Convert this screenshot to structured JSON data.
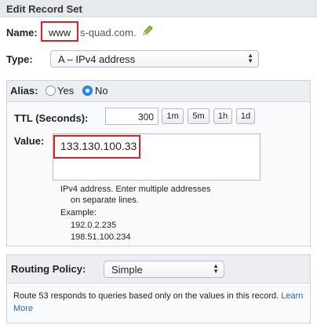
{
  "header": {
    "title": "Edit Record Set"
  },
  "name": {
    "label": "Name:",
    "value": "www",
    "suffix": "s-quad.com.",
    "edit_icon": "pencil-icon"
  },
  "type": {
    "label": "Type:",
    "selected": "A – IPv4 address"
  },
  "alias": {
    "label": "Alias:",
    "yes_label": "Yes",
    "no_label": "No",
    "selected": "No"
  },
  "ttl": {
    "label": "TTL (Seconds):",
    "value": "300",
    "buttons": [
      "1m",
      "5m",
      "1h",
      "1d"
    ]
  },
  "value": {
    "label": "Value:",
    "text": "133.130.100.33",
    "help_line1": "IPv4 address. Enter multiple addresses",
    "help_line2": "on separate lines.",
    "example_label": "Example:",
    "example1": "192.0.2.235",
    "example2": "198.51.100.234"
  },
  "routing": {
    "label": "Routing Policy:",
    "selected": "Simple",
    "description": "Route 53 responds to queries based only on the values in this record.",
    "learn_more": "Learn More"
  }
}
